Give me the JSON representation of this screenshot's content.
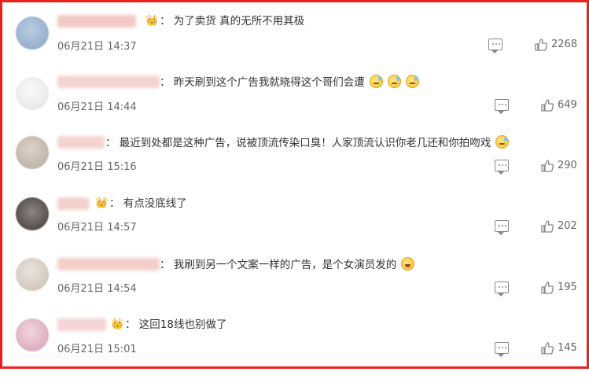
{
  "comments": [
    {
      "separator": "：",
      "text": "为了卖货 真的无所不用其极",
      "time": "06月21日 14:37",
      "likes": "2268",
      "has_badge": true,
      "emojis": [],
      "avatar_color": "#9fb3cc"
    },
    {
      "separator": "：",
      "text": "昨天刷到这个广告我就晓得这个哥们会遭",
      "time": "06月21日 14:44",
      "likes": "649",
      "has_badge": false,
      "emojis": [
        "sweat-smile-emoji",
        "sweat-smile-emoji",
        "sweat-smile-emoji"
      ],
      "avatar_color": "#eeeeee"
    },
    {
      "separator": "：",
      "text": "最近到处都是这种广告，说被顶流传染口臭！人家顶流认识你老几还和你拍吻戏",
      "time": "06月21日 15:16",
      "likes": "290",
      "has_badge": false,
      "emojis": [
        "sweat-smile-emoji"
      ],
      "avatar_color": "#c9bdb3"
    },
    {
      "separator": "：",
      "text": "有点没底线了",
      "time": "06月21日 14:57",
      "likes": "202",
      "has_badge": true,
      "emojis": [],
      "avatar_color": "#6b6462"
    },
    {
      "separator": "：",
      "text": "我刷到另一个文案一样的广告，是个女演员发的",
      "time": "06月21日 14:54",
      "likes": "195",
      "has_badge": false,
      "emojis": [
        "laughing-tears-emoji"
      ],
      "avatar_color": "#d8cfc7"
    },
    {
      "separator": "：",
      "text": "这回18线也别做了",
      "time": "06月21日 15:01",
      "likes": "145",
      "has_badge": true,
      "emojis": [],
      "avatar_color": "#e2b9c8"
    }
  ],
  "colors": {
    "frame_border": "#e8211c",
    "text": "#333333",
    "meta": "#666666",
    "icon": "#888888"
  }
}
